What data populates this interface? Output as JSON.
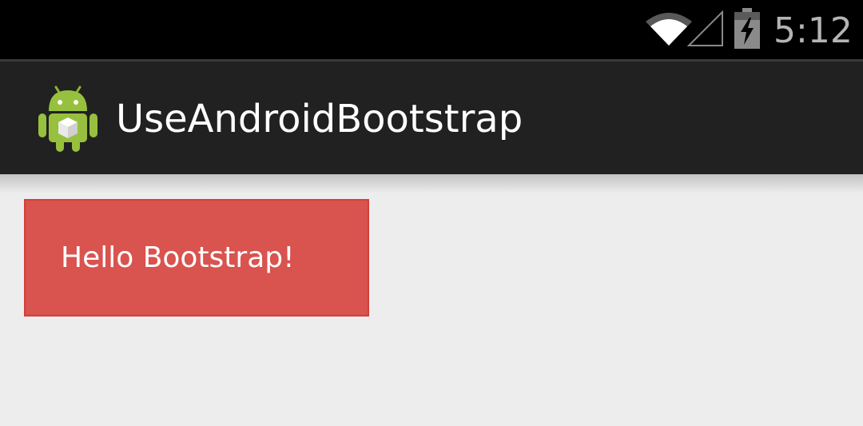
{
  "status_bar": {
    "time": "5:12",
    "icons": [
      "wifi-icon",
      "cell-signal-icon",
      "battery-charging-icon"
    ]
  },
  "action_bar": {
    "app_icon": "android-robot-icon",
    "title": "UseAndroidBootstrap"
  },
  "main": {
    "button_label": "Hello Bootstrap!",
    "button_color": "#d9534f",
    "button_border_color": "#d43f3a"
  },
  "colors": {
    "status_bar_bg": "#000000",
    "action_bar_bg": "#212121",
    "content_bg": "#ededed",
    "clock_text": "#b4b4b4"
  }
}
